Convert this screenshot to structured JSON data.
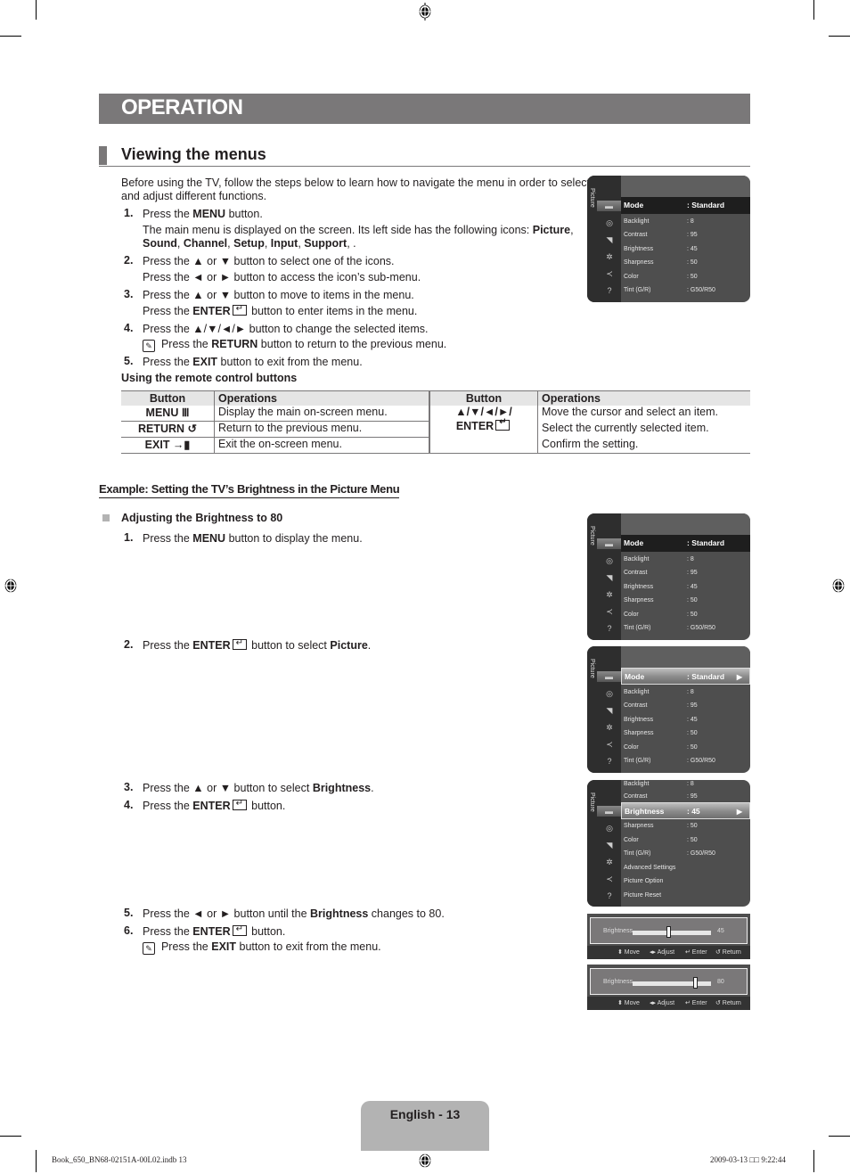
{
  "header": {
    "title": "OPERATION",
    "section": "Viewing the menus"
  },
  "intro": "Before using the TV, follow the steps below to learn how to navigate the menu in order to select",
  "intro2": "and adjust different functions.",
  "steps": [
    {
      "n": "1.",
      "pre": "Press the ",
      "b": "MENU",
      "post": " button."
    },
    {
      "n": "",
      "line": "The main menu is displayed on the screen. Its left side has the following icons: ",
      "b": "Picture",
      "post": ","
    },
    {
      "n": "",
      "icons": [
        "Sound",
        "Channel",
        "Setup",
        "Input",
        "Support"
      ]
    },
    {
      "n": "2.",
      "line": "Press the ▲ or ▼ button to select one of the icons."
    },
    {
      "n": "",
      "line": "Press the ◄ or ► button to access the icon’s sub-menu."
    },
    {
      "n": "3.",
      "line": "Press the ▲ or ▼ button to move to items in the menu."
    },
    {
      "n": "",
      "pre": "Press the ",
      "b": "ENTER",
      "post": " button to enter items in the menu."
    },
    {
      "n": "4.",
      "line": "Press the ▲/▼/◄/► button to change the selected items."
    },
    {
      "n": "",
      "pre": "Press the ",
      "b": "RETURN",
      "post": " button to return to the previous menu."
    },
    {
      "n": "5.",
      "pre": "Press the ",
      "b": "EXIT",
      "post": " button to exit from the menu."
    }
  ],
  "remote": {
    "title": "Using the remote control buttons",
    "headers": [
      "Button",
      "Operations",
      "Button",
      "Operations"
    ],
    "left": [
      {
        "button": "MENU Ⅲ",
        "op": "Display the main on-screen menu."
      },
      {
        "button": "RETURN ↺",
        "op": "Return to the previous menu."
      },
      {
        "button": "EXIT →▮",
        "op": "Exit the on-screen menu."
      }
    ],
    "right_button": [
      "▲/▼/◄/►/",
      "ENTER"
    ],
    "right_ops": [
      "Move the cursor and select an item.",
      "Select the currently selected item.",
      "Confirm the setting."
    ]
  },
  "example": {
    "title": "Example: Setting the TV’s Brightness in the Picture Menu",
    "subtitle": "Adjusting the Brightness to 80",
    "s1": {
      "n": "1.",
      "pre": "Press the ",
      "b": "MENU",
      "post": " button to display the menu."
    },
    "s2": {
      "n": "2.",
      "pre": "Press the ",
      "b": "ENTER",
      "mid": " button to select ",
      "b2": "Picture",
      "post": "."
    },
    "s3": {
      "n": "3.",
      "pre": "Press the ▲ or ▼ button to select ",
      "b": "Brightness",
      "post": "."
    },
    "s4": {
      "n": "4.",
      "pre": "Press the ",
      "b": "ENTER",
      "post": " button."
    },
    "s5": {
      "n": "5.",
      "pre": "Press the ◄ or ► button until the ",
      "b": "Brightness",
      "post": " changes to 80."
    },
    "s6": {
      "n": "6.",
      "pre": "Press the ",
      "b": "ENTER",
      "post": " button."
    },
    "note": {
      "pre": "Press the ",
      "b": "EXIT",
      "post": " button to exit from the menu."
    }
  },
  "tv_menu": {
    "side_label": "Picture",
    "icons": [
      "picture-icon",
      "sound-icon",
      "channel-icon",
      "setup-icon",
      "input-icon",
      "support-icon"
    ],
    "items": [
      {
        "k": "Mode",
        "v": ": Standard"
      },
      {
        "k": "Backlight",
        "v": ": 8"
      },
      {
        "k": "Contrast",
        "v": ": 95"
      },
      {
        "k": "Brightness",
        "v": ": 45"
      },
      {
        "k": "Sharpness",
        "v": ": 50"
      },
      {
        "k": "Color",
        "v": ": 50"
      },
      {
        "k": "Tint (G/R)",
        "v": ": G50/R50"
      },
      {
        "k": "Advanced Settings",
        "v": ""
      },
      {
        "k": "Picture Option",
        "v": ""
      },
      {
        "k": "Picture Reset",
        "v": ""
      }
    ]
  },
  "osd": {
    "label": "Brightness",
    "values": [
      "45",
      "80"
    ],
    "levels": [
      0.45,
      0.8
    ],
    "footer": [
      "Move",
      "Adjust",
      "Enter",
      "Return"
    ]
  },
  "footer": {
    "page": "English - 13",
    "file": "Book_650_BN68-02151A-00L02.indb   13",
    "date": "2009-03-13   □□ 9:22:44"
  }
}
